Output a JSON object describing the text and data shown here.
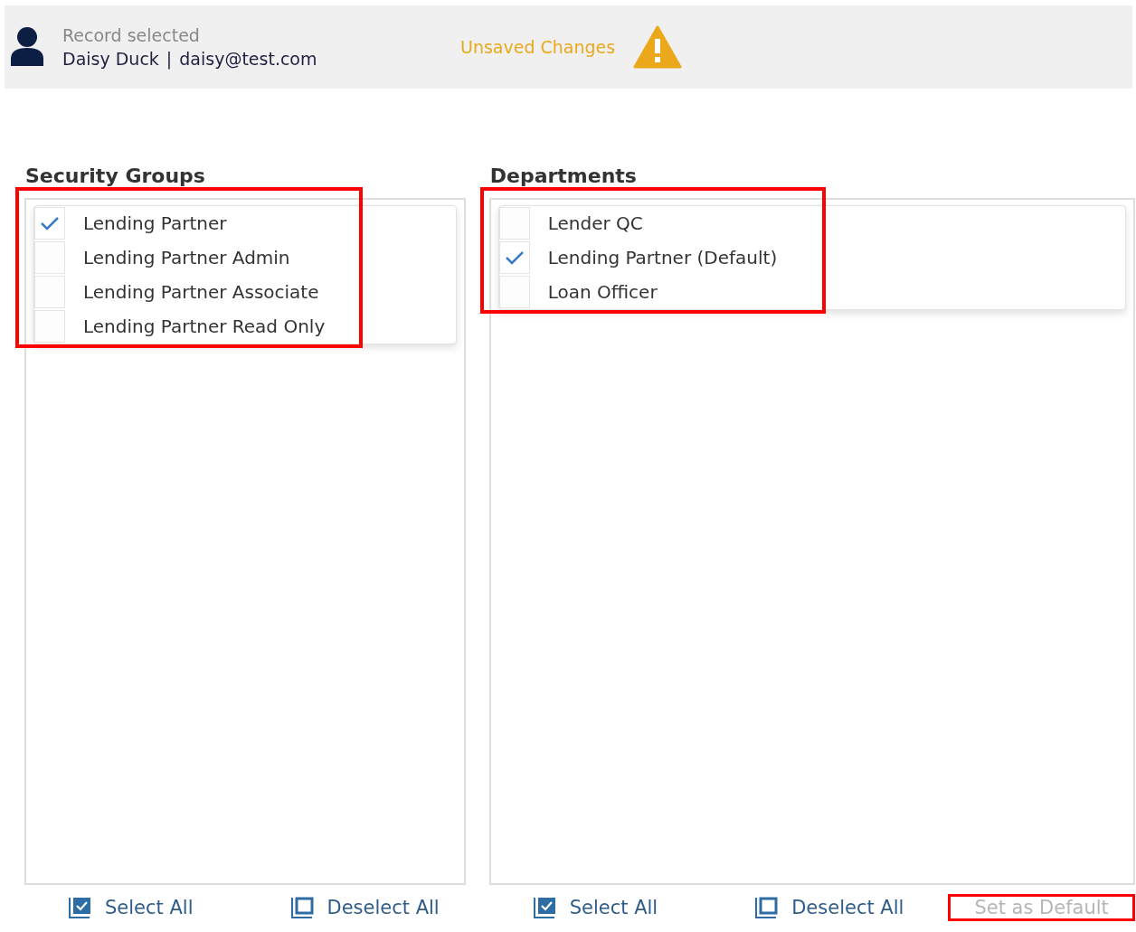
{
  "header": {
    "caption": "Record selected",
    "user": "Daisy Duck",
    "separator": "|",
    "email": "daisy@test.com",
    "status": "Unsaved Changes"
  },
  "panels": [
    {
      "title": "Security Groups",
      "highlighted": true,
      "items": [
        {
          "label": "Lending Partner",
          "checked": true
        },
        {
          "label": "Lending Partner Admin",
          "checked": false
        },
        {
          "label": "Lending Partner Associate",
          "checked": false
        },
        {
          "label": "Lending Partner Read Only",
          "checked": false
        }
      ],
      "actions": [
        {
          "kind": "select",
          "label": "Select All",
          "disabled": false,
          "highlighted": false
        },
        {
          "kind": "deselect",
          "label": "Deselect All",
          "disabled": false,
          "highlighted": false
        }
      ]
    },
    {
      "title": "Departments",
      "highlighted": true,
      "items": [
        {
          "label": "Lender QC",
          "checked": false
        },
        {
          "label": "Lending Partner (Default)",
          "checked": true
        },
        {
          "label": "Loan Officer",
          "checked": false
        }
      ],
      "actions": [
        {
          "kind": "select",
          "label": "Select All",
          "disabled": false,
          "highlighted": false
        },
        {
          "kind": "deselect",
          "label": "Deselect All",
          "disabled": false,
          "highlighted": false
        },
        {
          "kind": "text",
          "label": "Set as Default",
          "disabled": true,
          "highlighted": true
        }
      ]
    }
  ]
}
